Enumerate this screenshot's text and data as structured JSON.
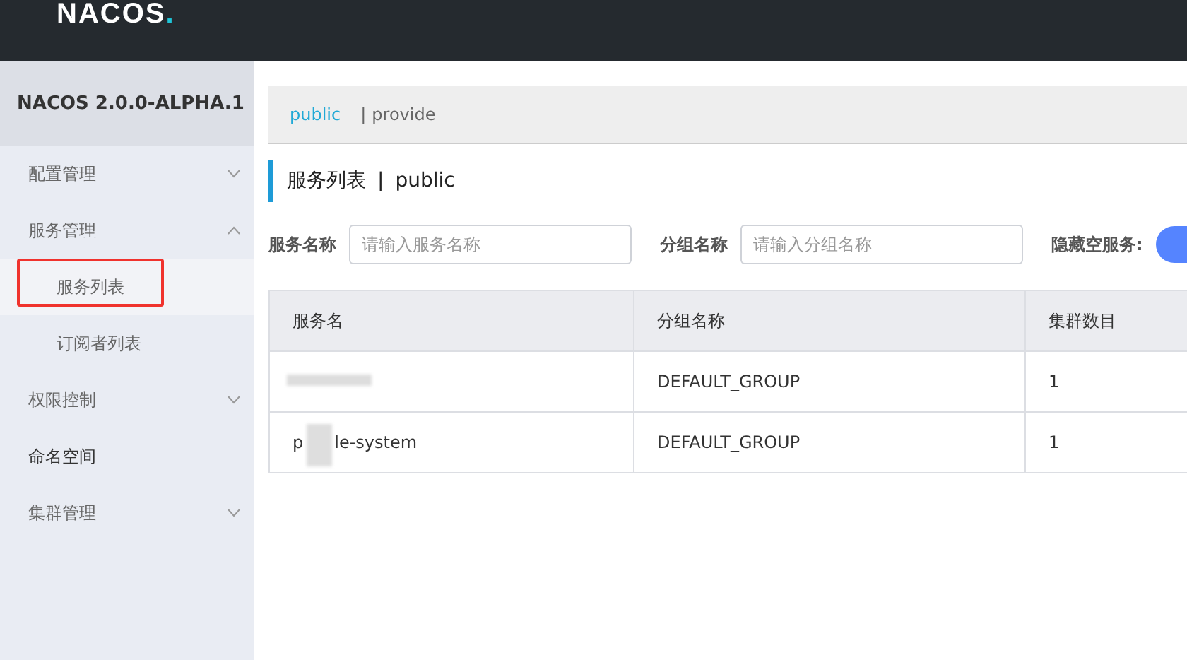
{
  "header": {
    "logo": {
      "text": "NACOS",
      "mark": "."
    }
  },
  "sidebar": {
    "version": "NACOS 2.0.0-ALPHA.1",
    "items": [
      {
        "label": "配置管理",
        "kind": "group",
        "expanded": false
      },
      {
        "label": "服务管理",
        "kind": "group",
        "expanded": true,
        "children": [
          {
            "label": "服务列表",
            "selected": true,
            "highlighted": true
          },
          {
            "label": "订阅者列表",
            "selected": false,
            "highlighted": false
          }
        ]
      },
      {
        "label": "权限控制",
        "kind": "group",
        "expanded": false
      },
      {
        "label": "命名空间",
        "kind": "link"
      },
      {
        "label": "集群管理",
        "kind": "group",
        "expanded": false
      }
    ]
  },
  "namespaces": [
    {
      "label": "public",
      "selected": true
    },
    {
      "separator": "|",
      "label": "provide",
      "selected": false
    }
  ],
  "page_title": {
    "title": "服务列表",
    "separator": "|",
    "namespace": "public"
  },
  "filters": [
    {
      "label": "服务名称",
      "placeholder": "请输入服务名称"
    },
    {
      "label": "分组名称",
      "placeholder": "请输入分组名称"
    }
  ],
  "hide_empty": {
    "label": "隐藏空服务:",
    "on": true
  },
  "table": {
    "columns": [
      "服务名",
      "分组名称",
      "集群数目"
    ],
    "rows": [
      {
        "name_parts": [],
        "redacted": true,
        "group": "DEFAULT_GROUP",
        "clusters": "1"
      },
      {
        "name_parts": [
          "p",
          "le-system"
        ],
        "redacted": true,
        "group": "DEFAULT_GROUP",
        "clusters": "1"
      }
    ]
  }
}
